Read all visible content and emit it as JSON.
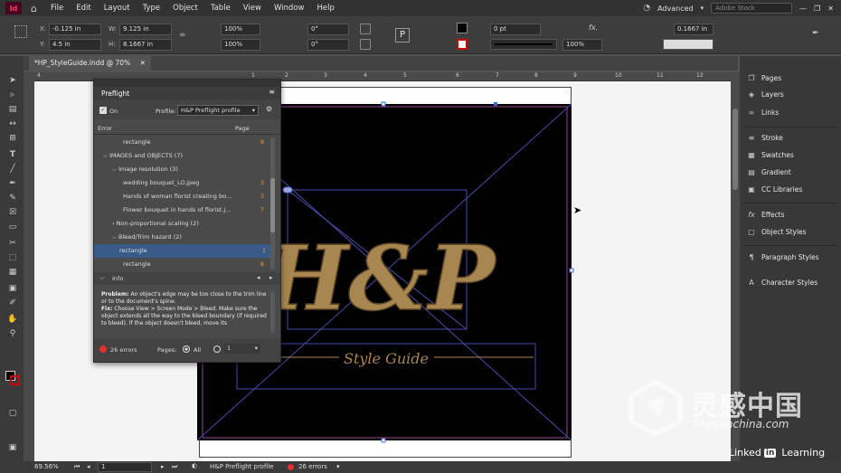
{
  "app": {
    "logo": "Id",
    "menus": [
      "File",
      "Edit",
      "Layout",
      "Type",
      "Object",
      "Table",
      "View",
      "Window",
      "Help"
    ],
    "workspace": "Advanced",
    "search_placeholder": "Adobe Stock"
  },
  "control": {
    "x": "-0.125 in",
    "y": "4.5 in",
    "w": "9.125 in",
    "h": "8.1667 in",
    "scale_x": "100%",
    "scale_y": "100%",
    "rotate": "0°",
    "shear": "0°",
    "stroke_weight": "0 pt",
    "opacity": "100%",
    "right_field": "0.1667 in",
    "x_label": "X:",
    "y_label": "Y:",
    "w_label": "W:",
    "h_label": "H:"
  },
  "doc_tab": "*HP_StyleGuide.indd @ 70%",
  "ruler": [
    "4",
    "1",
    "2",
    "3",
    "4",
    "5",
    "6",
    "7",
    "8",
    "9",
    "10",
    "11",
    "12"
  ],
  "canvas": {
    "logo": "H&P",
    "subtitle": "Style Guide"
  },
  "preflight": {
    "title": "Preflight",
    "on_label": "On",
    "profile_label": "Profile:",
    "profile_value": "H&P Preflight profile",
    "col_error": "Error",
    "col_page": "Page",
    "rows": [
      {
        "label": "rectangle",
        "page": "8"
      },
      {
        "label": "IMAGES and OBJECTS (7)",
        "page": ""
      },
      {
        "label": "Image resolution (3)",
        "page": ""
      },
      {
        "label": "wedding bouquet_LO.jpeg",
        "page": "3"
      },
      {
        "label": "Hands of woman florist creating bo...",
        "page": "3"
      },
      {
        "label": "Flower bouquet in hands of florist.j...",
        "page": "7"
      },
      {
        "label": "Non-proportional scaling (2)",
        "page": ""
      },
      {
        "label": "Bleed/Trim hazard (2)",
        "page": ""
      },
      {
        "label": "rectangle",
        "page": "1"
      },
      {
        "label": "rectangle",
        "page": "8"
      }
    ],
    "info_label": "Info",
    "problem_label": "Problem:",
    "problem_text": "An object's edge may be too close to the trim line or to the document's spine.",
    "fix_label": "Fix:",
    "fix_text": "Choose View > Screen Mode > Bleed. Make sure the object extends all the way to the bleed boundary (if required to bleed). If the object doesn't bleed, move its",
    "errors": "26 errors",
    "pages_label": "Pages:",
    "all_label": "All",
    "page_field": "1"
  },
  "panels": [
    "Pages",
    "Layers",
    "Links",
    "Stroke",
    "Swatches",
    "Gradient",
    "CC Libraries",
    "Effects",
    "Object Styles",
    "Paragraph Styles",
    "Character Styles"
  ],
  "status": {
    "zoom": "69.56%",
    "page": "1",
    "profile": "H&P Preflight profile",
    "errors": "26 errors"
  },
  "watermark": {
    "cn": "灵感中国",
    "url": "lingganchina.com",
    "linkedin": "Linked",
    "learning": "Learning",
    "in": "in"
  },
  "colors": {
    "gold": "#a8864f",
    "frame_blue": "#4a4aa8",
    "error_red": "#e03030",
    "accent": "#e89a3c"
  }
}
